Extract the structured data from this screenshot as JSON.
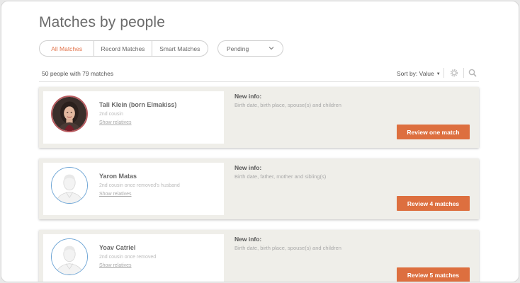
{
  "page": {
    "title": "Matches by people"
  },
  "filters": {
    "tabs": [
      {
        "label": "All Matches",
        "active": true
      },
      {
        "label": "Record Matches",
        "active": false
      },
      {
        "label": "Smart Matches",
        "active": false
      }
    ],
    "status_dropdown": {
      "selected": "Pending"
    }
  },
  "toolbar": {
    "summary": "50 people with 79 matches",
    "sort_label": "Sort by: Value",
    "icons": [
      "gear-icon",
      "search-icon"
    ]
  },
  "colors": {
    "accent": "#e2734a",
    "button": "#dd6f3f",
    "card_bg": "#efeee9",
    "avatar_border_blue": "#6fa6d6"
  },
  "matches": [
    {
      "name": "Tali Klein (born Elmakiss)",
      "relation": "2nd cousin",
      "link": "Show relatives",
      "info_title": "New info:",
      "info_text": "Birth date, birth place, spouse(s) and children",
      "button": "Review one match",
      "avatar": "photo"
    },
    {
      "name": "Yaron Matas",
      "relation": "2nd cousin once removed's husband",
      "link": "Show relatives",
      "info_title": "New info:",
      "info_text": "Birth date, father, mother and sibling(s)",
      "button": "Review 4 matches",
      "avatar": "silhouette"
    },
    {
      "name": "Yoav Catriel",
      "relation": "2nd cousin once removed",
      "link": "Show relatives",
      "info_title": "New info:",
      "info_text": "Birth date, birth place, spouse(s) and children",
      "button": "Review 5 matches",
      "avatar": "silhouette"
    }
  ]
}
